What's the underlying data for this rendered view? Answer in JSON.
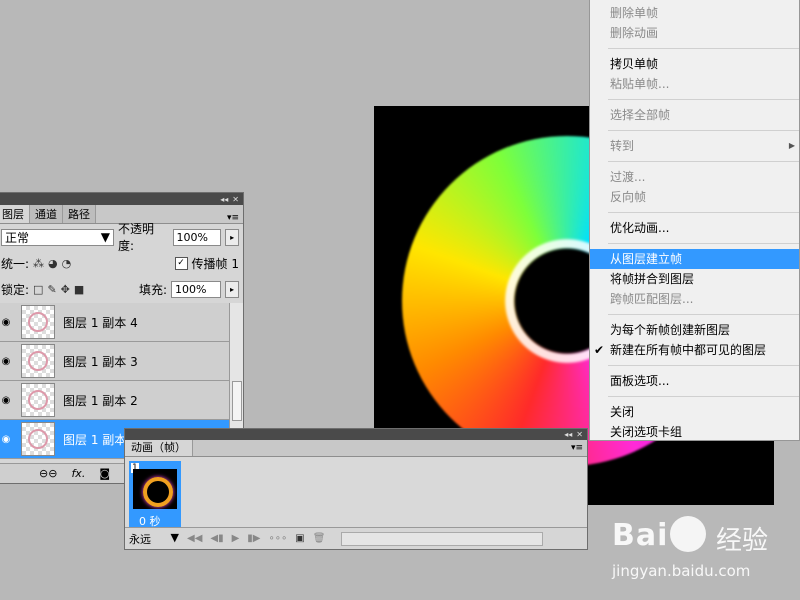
{
  "layers_panel": {
    "tabs": [
      "图层",
      "通道",
      "路径"
    ],
    "blend_mode": "正常",
    "opacity_label": "不透明度:",
    "opacity_value": "100%",
    "unify_label": "统一:",
    "propagate_label": "传播帧 1",
    "lock_label": "锁定:",
    "fill_label": "填充:",
    "fill_value": "100%",
    "layers": [
      "图层 1 副本 4",
      "图层 1 副本 3",
      "图层 1 副本 2",
      "图层 1 副本"
    ],
    "selected_layer": "图层 1 副本",
    "footer_icons": [
      "link-icon",
      "fx-icon",
      "mask-icon"
    ]
  },
  "animation_panel": {
    "tab": "动画（帧）",
    "frame_number": "1",
    "frame_delay": "0 秒",
    "loop_option": "永远"
  },
  "context_menu": {
    "items": [
      {
        "label": "删除单帧",
        "disabled": true
      },
      {
        "label": "删除动画",
        "disabled": true
      },
      {
        "sep": true
      },
      {
        "label": "拷贝单帧",
        "disabled": false
      },
      {
        "label": "粘贴单帧...",
        "disabled": true
      },
      {
        "sep": true
      },
      {
        "label": "选择全部帧",
        "disabled": true
      },
      {
        "sep": true
      },
      {
        "label": "转到",
        "disabled": true,
        "submenu": true
      },
      {
        "sep": true
      },
      {
        "label": "过渡...",
        "disabled": true
      },
      {
        "label": "反向帧",
        "disabled": true
      },
      {
        "sep": true
      },
      {
        "label": "优化动画...",
        "disabled": false
      },
      {
        "sep": true
      },
      {
        "label": "从图层建立帧",
        "disabled": false,
        "highlight": true
      },
      {
        "label": "将帧拼合到图层",
        "disabled": false
      },
      {
        "label": "跨帧匹配图层...",
        "disabled": true
      },
      {
        "sep": true
      },
      {
        "label": "为每个新帧创建新图层",
        "disabled": false
      },
      {
        "label": "新建在所有帧中都可见的图层",
        "disabled": false,
        "checked": true
      },
      {
        "sep": true
      },
      {
        "label": "面板选项...",
        "disabled": false
      },
      {
        "sep": true
      },
      {
        "label": "关闭",
        "disabled": false
      },
      {
        "label": "关闭选项卡组",
        "disabled": false
      }
    ]
  },
  "watermark": {
    "brand": "Bai",
    "brand2": "经验",
    "url": "jingyan.baidu.com"
  }
}
